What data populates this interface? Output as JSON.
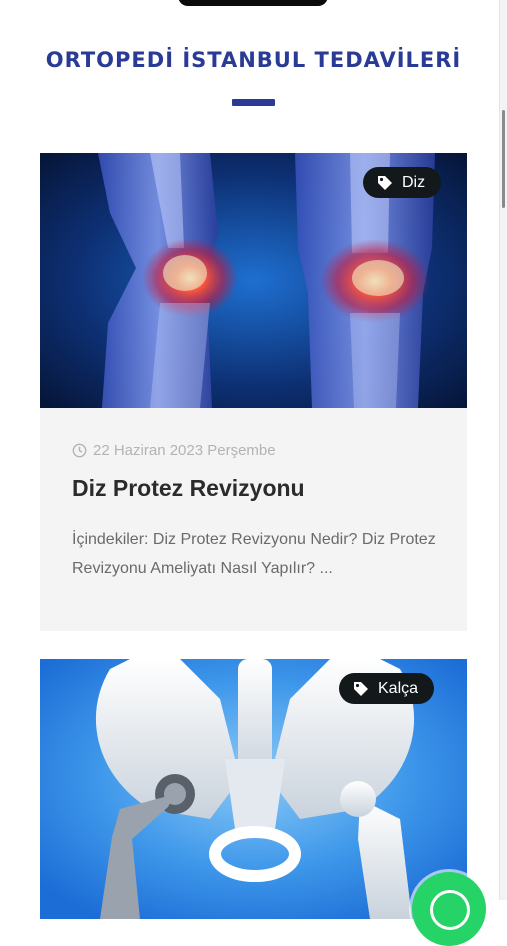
{
  "section": {
    "title": "ORTOPEDİ İSTANBUL TEDAVİLERİ"
  },
  "posts": [
    {
      "tag": "Diz",
      "date": "22 Haziran 2023 Perşembe",
      "title": "Diz Protez Revizyonu",
      "excerpt": "İçindekiler: Diz Protez Revizyonu Nedir? Diz Protez Revizyonu Ameliyatı Nasıl Yapılır? ..."
    },
    {
      "tag": "Kalça"
    }
  ],
  "colors": {
    "accent": "#2a3b96",
    "tag_bg": "#13181b",
    "whatsapp": "#25d366"
  }
}
